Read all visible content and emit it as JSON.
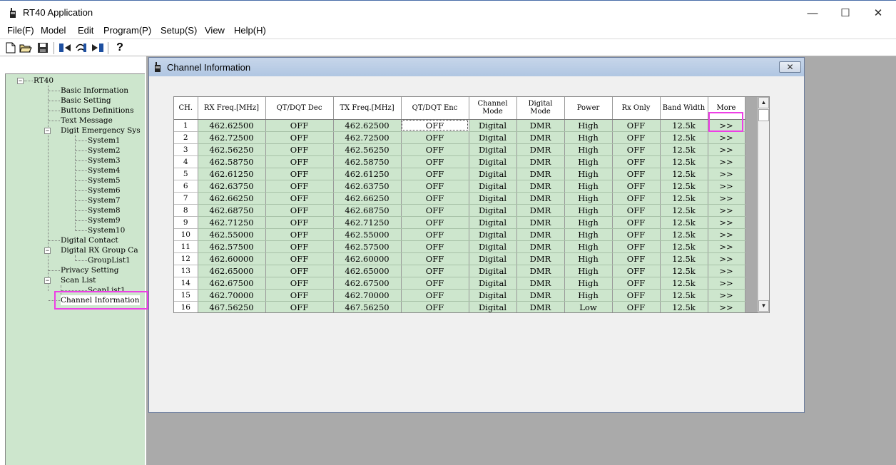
{
  "window": {
    "title": "RT40 Application",
    "minimize": "—",
    "maximize": "☐",
    "close": "✕"
  },
  "menu": [
    "File(F)",
    "Model",
    "Edit",
    "Program(P)",
    "Setup(S)",
    "View",
    "Help(H)"
  ],
  "toolbar": {
    "icons": [
      "new-file-icon",
      "open-folder-icon",
      "save-icon",
      "read-radio-icon",
      "write-radio-icon",
      "radio-info-icon",
      "help-icon"
    ],
    "help_glyph": "?"
  },
  "tree": {
    "root": "RT40",
    "items": [
      "Basic Information",
      "Basic Setting",
      "Buttons Definitions",
      "Text Message",
      "Digit Emergency Sys",
      "System1",
      "System2",
      "System3",
      "System4",
      "System5",
      "System6",
      "System7",
      "System8",
      "System9",
      "System10",
      "Digital Contact",
      "Digital RX Group Ca",
      "GroupList1",
      "Privacy Setting",
      "Scan List",
      "ScanList1",
      "Channel Information"
    ],
    "expander_glyph": "−"
  },
  "channel_window": {
    "title": "Channel Information",
    "close": "✕"
  },
  "table": {
    "headers": [
      "CH.",
      "RX Freq.[MHz]",
      "QT/DQT Dec",
      "TX Freq.[MHz]",
      "QT/DQT Enc",
      "Channel Mode",
      "Digital Mode",
      "Power",
      "Rx Only",
      "Band Width",
      "More"
    ],
    "rows": [
      [
        "1",
        "462.62500",
        "OFF",
        "462.62500",
        "OFF",
        "Digital",
        "DMR",
        "High",
        "OFF",
        "12.5k",
        ">>"
      ],
      [
        "2",
        "462.72500",
        "OFF",
        "462.72500",
        "OFF",
        "Digital",
        "DMR",
        "High",
        "OFF",
        "12.5k",
        ">>"
      ],
      [
        "3",
        "462.56250",
        "OFF",
        "462.56250",
        "OFF",
        "Digital",
        "DMR",
        "High",
        "OFF",
        "12.5k",
        ">>"
      ],
      [
        "4",
        "462.58750",
        "OFF",
        "462.58750",
        "OFF",
        "Digital",
        "DMR",
        "High",
        "OFF",
        "12.5k",
        ">>"
      ],
      [
        "5",
        "462.61250",
        "OFF",
        "462.61250",
        "OFF",
        "Digital",
        "DMR",
        "High",
        "OFF",
        "12.5k",
        ">>"
      ],
      [
        "6",
        "462.63750",
        "OFF",
        "462.63750",
        "OFF",
        "Digital",
        "DMR",
        "High",
        "OFF",
        "12.5k",
        ">>"
      ],
      [
        "7",
        "462.66250",
        "OFF",
        "462.66250",
        "OFF",
        "Digital",
        "DMR",
        "High",
        "OFF",
        "12.5k",
        ">>"
      ],
      [
        "8",
        "462.68750",
        "OFF",
        "462.68750",
        "OFF",
        "Digital",
        "DMR",
        "High",
        "OFF",
        "12.5k",
        ">>"
      ],
      [
        "9",
        "462.71250",
        "OFF",
        "462.71250",
        "OFF",
        "Digital",
        "DMR",
        "High",
        "OFF",
        "12.5k",
        ">>"
      ],
      [
        "10",
        "462.55000",
        "OFF",
        "462.55000",
        "OFF",
        "Digital",
        "DMR",
        "High",
        "OFF",
        "12.5k",
        ">>"
      ],
      [
        "11",
        "462.57500",
        "OFF",
        "462.57500",
        "OFF",
        "Digital",
        "DMR",
        "High",
        "OFF",
        "12.5k",
        ">>"
      ],
      [
        "12",
        "462.60000",
        "OFF",
        "462.60000",
        "OFF",
        "Digital",
        "DMR",
        "High",
        "OFF",
        "12.5k",
        ">>"
      ],
      [
        "13",
        "462.65000",
        "OFF",
        "462.65000",
        "OFF",
        "Digital",
        "DMR",
        "High",
        "OFF",
        "12.5k",
        ">>"
      ],
      [
        "14",
        "462.67500",
        "OFF",
        "462.67500",
        "OFF",
        "Digital",
        "DMR",
        "High",
        "OFF",
        "12.5k",
        ">>"
      ],
      [
        "15",
        "462.70000",
        "OFF",
        "462.70000",
        "OFF",
        "Digital",
        "DMR",
        "High",
        "OFF",
        "12.5k",
        ">>"
      ],
      [
        "16",
        "467.56250",
        "OFF",
        "467.56250",
        "OFF",
        "Digital",
        "DMR",
        "Low",
        "OFF",
        "12.5k",
        ">>"
      ]
    ]
  },
  "scrollbar": {
    "up": "▲",
    "down": "▼"
  },
  "colors": {
    "grid_cell": "#cde6cd",
    "tree_bg": "#cde6cd",
    "highlight": "#ee3ee6",
    "workspace": "#aaaaaa"
  }
}
